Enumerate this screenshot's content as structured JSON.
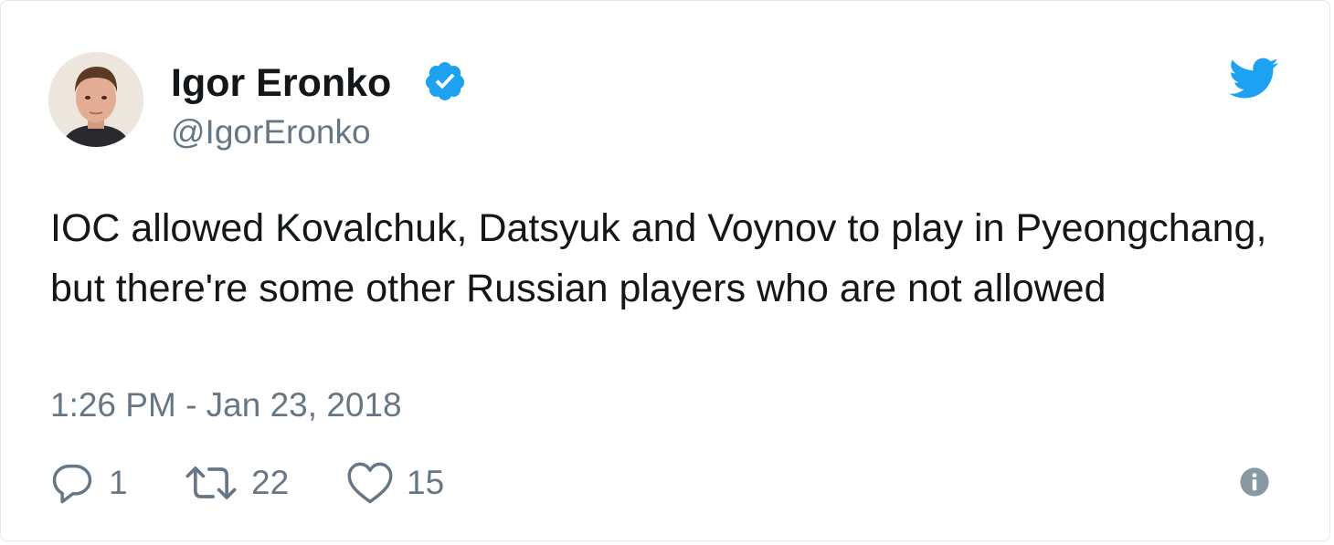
{
  "author": {
    "display_name": "Igor Eronko",
    "handle": "@IgorEronko",
    "verified": true
  },
  "tweet": {
    "text": "IOC allowed Kovalchuk, Datsyuk and Voynov to play in Pyeongchang, but there're some other Russian players who are not allowed",
    "timestamp": "1:26 PM - Jan 23, 2018"
  },
  "actions": {
    "reply_count": "1",
    "retweet_count": "22",
    "like_count": "15"
  },
  "icons": {
    "verified": "verified-badge-icon",
    "brand": "twitter-bird-icon",
    "reply": "reply-bubble-icon",
    "retweet": "retweet-arrows-icon",
    "like": "heart-icon",
    "info": "info-icon"
  },
  "colors": {
    "brand_blue": "#1da1f2",
    "text_primary": "#14171a",
    "text_secondary": "#657786",
    "info_gray": "#8899a6"
  }
}
